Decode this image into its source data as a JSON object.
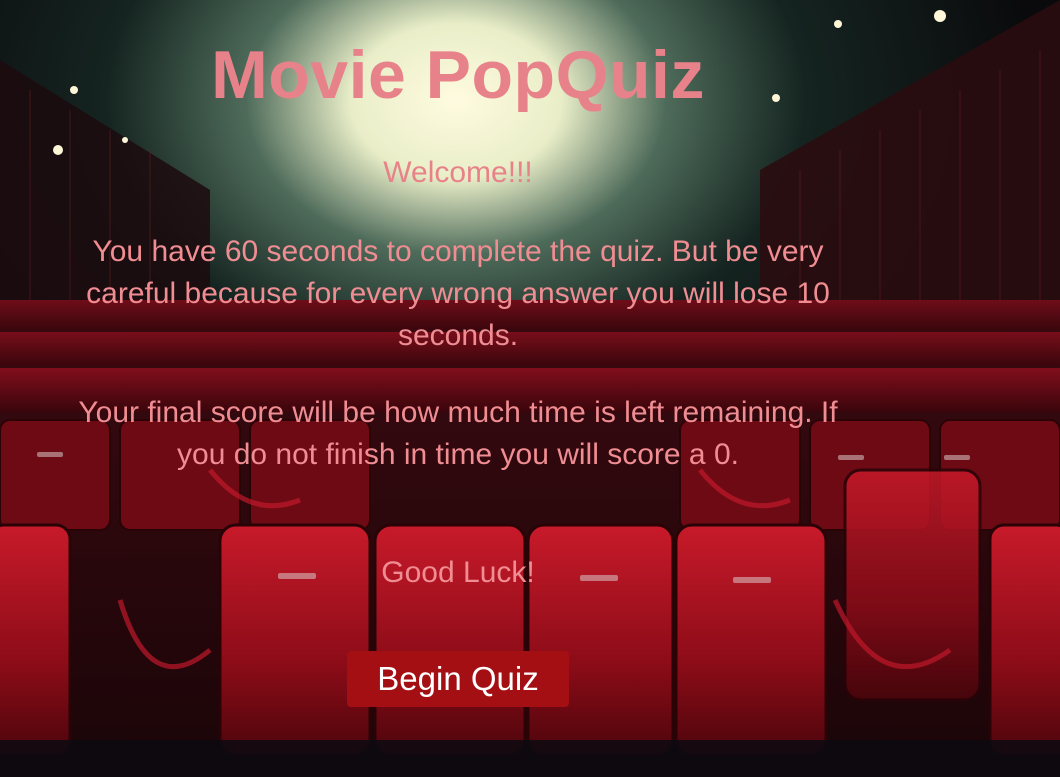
{
  "page": {
    "title": "Movie PopQuiz",
    "welcome": "Welcome!!!",
    "rules_paragraph_1": "You have 60 seconds to complete the quiz. But be very careful because for every wrong answer you will lose 10 seconds.",
    "rules_paragraph_2": "Your final score will be how much time is left remaining. If you do not finish in time you will score a 0.",
    "good_luck": "Good Luck!",
    "begin_button_label": "Begin Quiz"
  },
  "theme": {
    "title_color": "#e8828a",
    "text_color": "#f08d93",
    "button_color": "#a30f12",
    "button_text_color": "#ffffff"
  }
}
